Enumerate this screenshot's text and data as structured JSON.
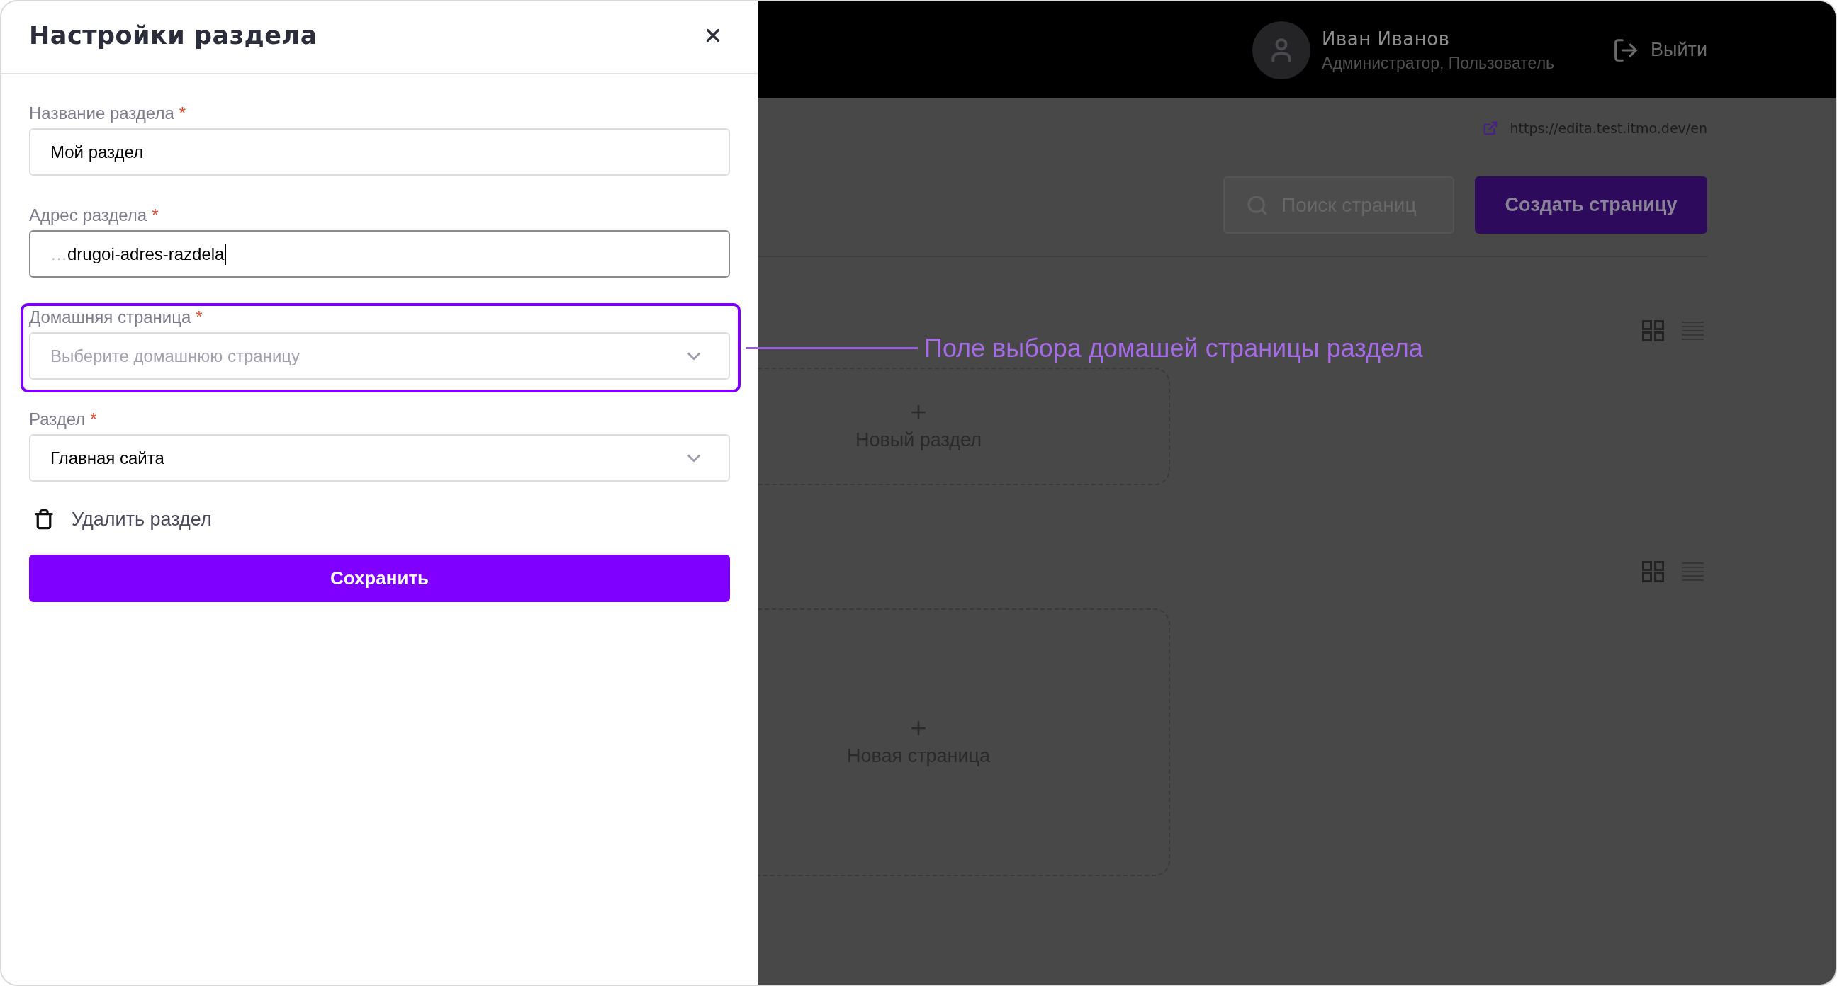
{
  "drawer": {
    "title": "Настройки раздела",
    "fields": [
      {
        "kind": "input",
        "label": "Название раздела",
        "required_mark": "*",
        "value": "Мой раздел",
        "focused": false,
        "highlighted": false
      },
      {
        "kind": "input",
        "label": "Адрес раздела",
        "required_mark": "*",
        "ellipsis": "…",
        "value": "drugoi-adres-razdela",
        "focused": true,
        "highlighted": false
      },
      {
        "kind": "select",
        "label": "Домашняя страница",
        "required_mark": "*",
        "placeholder": "Выберите домашнюю страницу",
        "highlighted": true,
        "callout": "Поле выбора домашей страницы раздела"
      },
      {
        "kind": "select",
        "label": "Раздел",
        "required_mark": "*",
        "value": "Главная сайта",
        "highlighted": false
      }
    ],
    "delete_action": "Удалить раздел",
    "save_button": "Сохранить"
  },
  "header": {
    "user": {
      "name": "Иван Иванов",
      "roles": "Администратор, Пользователь"
    },
    "logout": "Выйти"
  },
  "toolbar": {
    "site_link": "https://edita.test.itmo.dev/en",
    "search": {
      "placeholder": "Поиск страниц"
    },
    "create_button": "Создать страницу"
  },
  "sections": [
    {
      "kind": "sections",
      "view_options": [
        {
          "kind": "grid",
          "selected": true
        },
        {
          "kind": "list",
          "selected": false
        }
      ],
      "add_card": "Новый раздел"
    },
    {
      "kind": "pages",
      "view_options": [
        {
          "kind": "grid",
          "selected": true
        },
        {
          "kind": "list",
          "selected": false
        }
      ],
      "add_card": "Новая страница"
    }
  ]
}
